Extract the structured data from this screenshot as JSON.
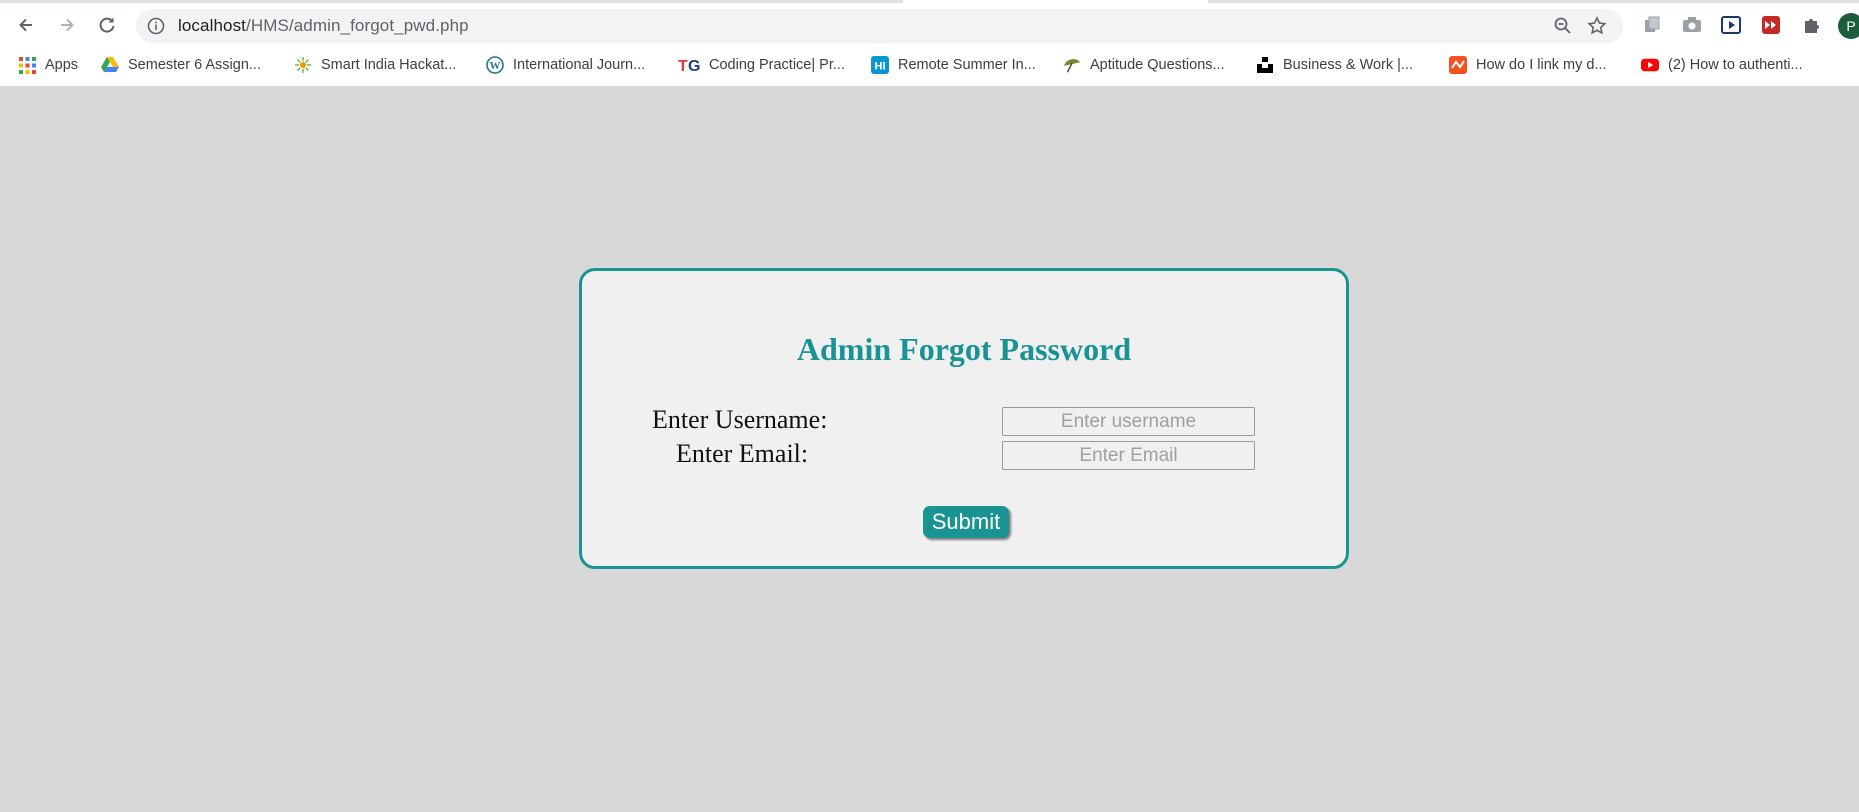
{
  "browser": {
    "url_host": "localhost",
    "url_path": "/HMS/admin_forgot_pwd.php",
    "profile_initial": "P",
    "bookmarks": [
      {
        "label": "Apps",
        "icon": "apps-grid-icon"
      },
      {
        "label": "Semester 6 Assign...",
        "icon": "google-drive-icon"
      },
      {
        "label": "Smart India Hackat...",
        "icon": "sih-logo-icon"
      },
      {
        "label": "International Journ...",
        "icon": "wordpress-icon"
      },
      {
        "label": "Coding Practice| Pr...",
        "icon": "tg-logo-icon"
      },
      {
        "label": "Remote Summer In...",
        "icon": "hi-logo-icon"
      },
      {
        "label": "Aptitude Questions...",
        "icon": "umbrella-icon"
      },
      {
        "label": "Business & Work |...",
        "icon": "unsplash-icon"
      },
      {
        "label": "How do I link my d...",
        "icon": "zapier-icon"
      },
      {
        "label": "(2) How to authenti...",
        "icon": "youtube-icon"
      }
    ]
  },
  "form": {
    "title": "Admin Forgot Password",
    "username_label": "Enter Username:",
    "username_placeholder": "Enter username",
    "email_label": "Enter Email:",
    "email_placeholder": "Enter Email",
    "submit_label": "Submit"
  },
  "colors": {
    "accent": "#1a9394",
    "page_bg": "#d8d8d8",
    "card_bg": "#f0f0f0"
  }
}
